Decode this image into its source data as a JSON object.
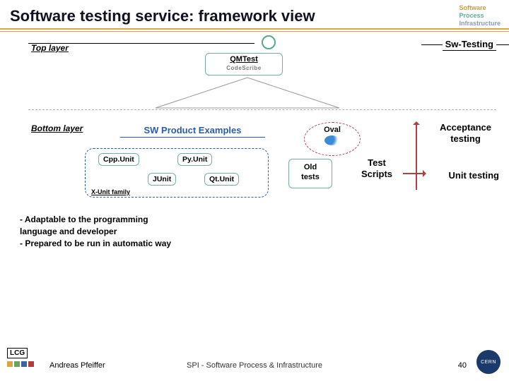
{
  "title": "Software testing service: framework view",
  "spi": {
    "s": "Software",
    "p": "Process",
    "i": "Infrastructure"
  },
  "labels": {
    "top_layer": "Top layer",
    "sw_testing": "Sw-Testing",
    "qmtest": "QMTest",
    "codescribe": "CodeScribe",
    "bottom_layer": "Bottom layer",
    "sw_product_examples": "SW Product Examples",
    "oval": "Oval",
    "old_tests_1": "Old",
    "old_tests_2": "tests",
    "test_scripts_1": "Test",
    "test_scripts_2": "Scripts",
    "acceptance_1": "Acceptance",
    "acceptance_2": "testing",
    "unit_testing": "Unit testing",
    "xunit_family": "X-Unit family"
  },
  "units": {
    "cpp": "Cpp.Unit",
    "py": "Py.Unit",
    "j": "JUnit",
    "qt": "Qt.Unit"
  },
  "notes": {
    "l1": "-  Adaptable to the programming",
    "l2": "language and developer",
    "l3": "- Prepared to be run in automatic way"
  },
  "footer": {
    "lcg": "LCG",
    "author": "Andreas Pfeiffer",
    "center": "SPI - Software Process & Infrastructure",
    "page": "40",
    "cern": "CERN"
  },
  "colors": {
    "bar1": "#d9a441",
    "bar2": "#6aa35a",
    "bar3": "#3a62a8",
    "bar4": "#b23b3b"
  }
}
